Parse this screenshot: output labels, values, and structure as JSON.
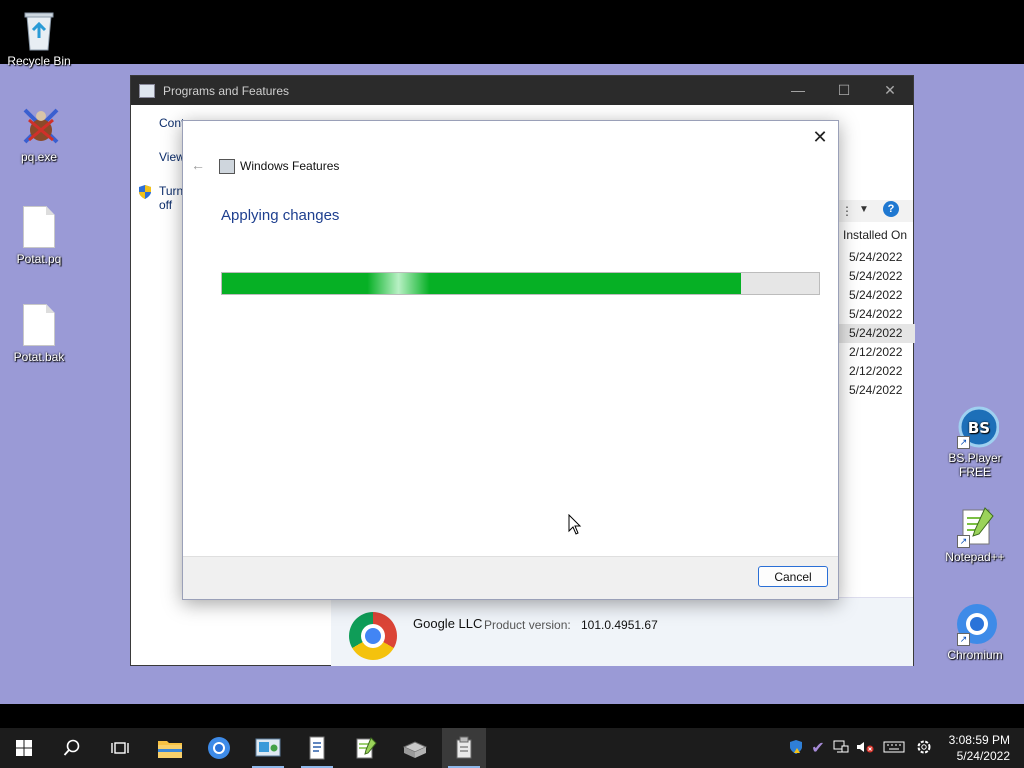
{
  "desktop": {
    "icons_left": [
      {
        "label": "Recycle Bin"
      },
      {
        "label": "pq.exe"
      },
      {
        "label": "Potat.pq"
      },
      {
        "label": "Potat.bak"
      }
    ],
    "icons_right": [
      {
        "label": "BS.Player FREE"
      },
      {
        "label": "Notepad++"
      },
      {
        "label": "Chromium"
      }
    ]
  },
  "programs_window": {
    "title": "Programs and Features",
    "left_links": [
      "Cont",
      "View",
      "Turn off"
    ],
    "column_header": "Installed On",
    "installed_dates": [
      "5/24/2022",
      "5/24/2022",
      "5/24/2022",
      "5/24/2022",
      "5/24/2022",
      "2/12/2022",
      "2/12/2022",
      "5/24/2022"
    ],
    "selected_row_index": 4,
    "details": {
      "publisher": "Google LLC",
      "product_version_label": "Product version:",
      "product_version_value": "101.0.4951.67"
    }
  },
  "features_dialog": {
    "title": "Windows Features",
    "heading": "Applying changes",
    "progress_fraction": 0.87,
    "cancel_label": "Cancel",
    "close_glyph": "✕",
    "back_glyph": "←"
  },
  "taskbar": {
    "time": "3:08:59 PM",
    "date": "5/24/2022"
  },
  "colors": {
    "progress_green": "#06b025",
    "desktop_bg": "#9a9ad6",
    "taskbar_bg": "#1c1c1c"
  }
}
